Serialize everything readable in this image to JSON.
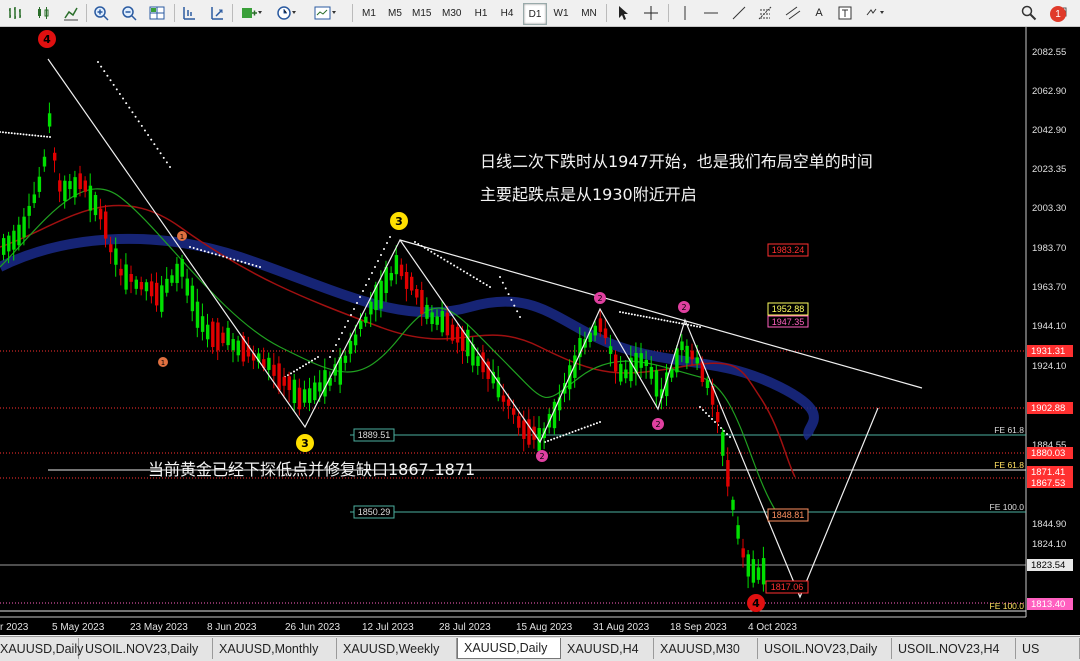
{
  "toolbar": {
    "timeframes": [
      "M1",
      "M5",
      "M15",
      "M30",
      "H1",
      "H4",
      "D1",
      "W1",
      "MN"
    ],
    "active_timeframe": "D1",
    "text_tool": "A",
    "notification_count": "1"
  },
  "chart": {
    "symbol": "XAUUSD",
    "timeframe": "Daily",
    "price_axis": [
      "2082.55",
      "2062.90",
      "2042.90",
      "2023.35",
      "2003.30",
      "1983.70",
      "1963.70",
      "1944.10",
      "1924.10",
      "1884.55",
      "1844.90",
      "1824.10"
    ],
    "current_price": "1823.54",
    "date_axis": [
      "r 2023",
      "5 May 2023",
      "23 May 2023",
      "8 Jun 2023",
      "26 Jun 2023",
      "12 Jul 2023",
      "28 Jul 2023",
      "15 Aug 2023",
      "31 Aug 2023",
      "18 Sep 2023",
      "4 Oct 2023"
    ],
    "price_tags": [
      {
        "label": "1983.24",
        "color": "#ff3030"
      },
      {
        "label": "1952.88",
        "color": "#ffff60"
      },
      {
        "label": "1947.35",
        "color": "#ff60c0"
      },
      {
        "label": "1931.31",
        "color": "#ff3030"
      },
      {
        "label": "1902.88",
        "color": "#ff3030"
      },
      {
        "label": "1880.03",
        "color": "#ff3030"
      },
      {
        "label": "1871.41",
        "color": "#ff3030"
      },
      {
        "label": "1867.53",
        "color": "#ff3030"
      },
      {
        "label": "1848.81",
        "color": "#ff9060"
      },
      {
        "label": "1817.06",
        "color": "#ff3030"
      },
      {
        "label": "1813.40",
        "color": "#ff60c0"
      }
    ],
    "level_boxes": [
      "1889.51",
      "1850.29"
    ],
    "fib_labels": [
      "FE 61.8",
      "FE 61.8",
      "FE 100.0",
      "FE 100.0"
    ],
    "annotation_line1": "日线二次下跌时从1947开始，也是我们布局空单的时间",
    "annotation_line2": "主要起跌点是从1930附近开启",
    "annotation_line3": "当前黄金已经下探低点并修复缺口1867-1871",
    "wave_labels": [
      "4",
      "3",
      "3",
      "1",
      "1",
      "2",
      "2",
      "2",
      "2",
      "4"
    ],
    "colors": {
      "background": "#000000",
      "bull": "#00e000",
      "bear": "#e00000",
      "wave_yellow": "#ffe000",
      "wave_red": "#e01010",
      "wave_pink": "#e040a0"
    }
  },
  "tabs": [
    "XAUUSD,Daily",
    "USOIL.NOV23,Daily",
    "XAUUSD,Monthly",
    "XAUUSD,Weekly",
    "XAUUSD,Daily",
    "XAUUSD,H4",
    "XAUUSD,M30",
    "USOIL.NOV23,Daily",
    "USOIL.NOV23,H4",
    "US"
  ],
  "active_tab_index": 4
}
